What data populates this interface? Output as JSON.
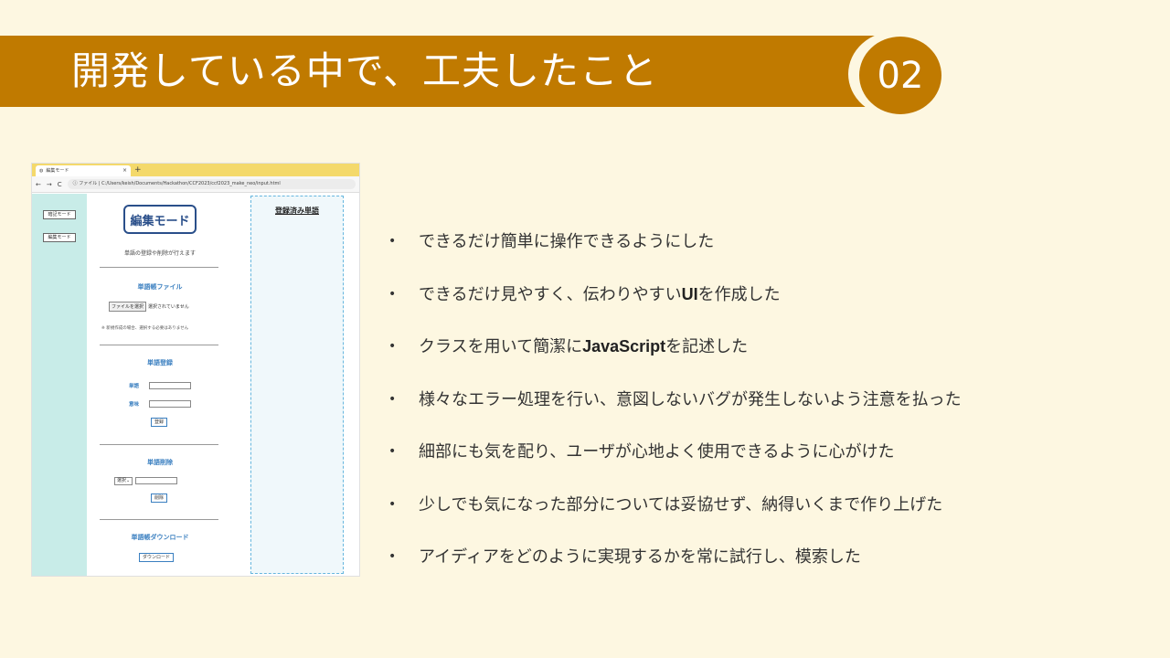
{
  "title": "開発している中で、工夫したこと",
  "badge": "02",
  "screenshot": {
    "tab_title": "編集モード",
    "tab_close": "×",
    "new_tab": "+",
    "nav": {
      "back": "←",
      "forward": "→",
      "reload": "C"
    },
    "url_prefix": "ファイル",
    "url": "C:/Users/keish/Documents/Hackathon/CCF2023/ccf2023_make_neo/input.html",
    "sidebar": [
      {
        "label": "暗記モード"
      },
      {
        "label": "編集モード"
      }
    ],
    "mode_title": "編集モード",
    "mode_subtitle": "単語の登録や削除が行えます",
    "file_section": {
      "heading": "単語帳ファイル",
      "choose_button": "ファイルを選択",
      "no_file": "選択されていません",
      "note": "※ 新規作成の場合、選択する必要はありません"
    },
    "register_section": {
      "heading": "単語登録",
      "word_label": "単語",
      "meaning_label": "意味",
      "button": "登録"
    },
    "delete_section": {
      "heading": "単語削除",
      "select": "選択",
      "button": "削除"
    },
    "download_section": {
      "heading": "単語帳ダウンロード",
      "button": "ダウンロード"
    },
    "registered_title": "登録済み単語"
  },
  "bullets": [
    {
      "pre": "できるだけ簡単に操作できるようにした",
      "bold": "",
      "post": ""
    },
    {
      "pre": "できるだけ見やすく、伝わりやすい",
      "bold": "UI",
      "post": "を作成した"
    },
    {
      "pre": "クラスを用いて簡潔に",
      "bold": "JavaScript",
      "post": "を記述した"
    },
    {
      "pre": "様々なエラー処理を行い、意図しないバグが発生しないよう注意を払った",
      "bold": "",
      "post": ""
    },
    {
      "pre": "細部にも気を配り、ユーザが心地よく使用できるように心がけた",
      "bold": "",
      "post": ""
    },
    {
      "pre": "少しでも気になった部分については妥協せず、納得いくまで作り上げた",
      "bold": "",
      "post": ""
    },
    {
      "pre": "アイディアをどのように実現するかを常に試行し、模索した",
      "bold": "",
      "post": ""
    }
  ],
  "bullet_char": "•",
  "colors": {
    "accent": "#c07a00",
    "background": "#fdf7e1",
    "sidebar": "#c8ece8",
    "link": "#3a7fc0"
  }
}
